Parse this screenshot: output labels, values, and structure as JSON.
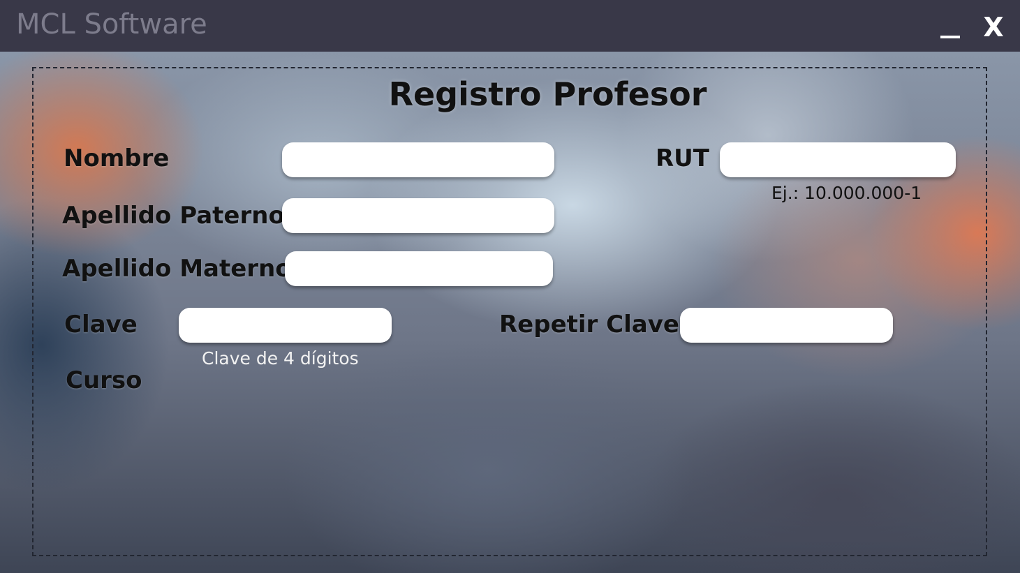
{
  "window": {
    "title": "MCL Software",
    "minimize_label": "_",
    "close_label": "X"
  },
  "form": {
    "title": "Registro Profesor",
    "fields": {
      "nombre": {
        "label": "Nombre",
        "value": ""
      },
      "apellido_paterno": {
        "label": "Apellido Paterno",
        "value": ""
      },
      "apellido_materno": {
        "label": "Apellido Materno",
        "value": ""
      },
      "rut": {
        "label": "RUT",
        "value": "",
        "hint": "Ej.: 10.000.000-1"
      },
      "clave": {
        "label": "Clave",
        "value": "",
        "hint": "Clave de 4 dígitos"
      },
      "repetir_clave": {
        "label": "Repetir Clave",
        "value": ""
      },
      "curso": {
        "label": "Curso"
      }
    }
  },
  "colors": {
    "titlebar": "#393848",
    "title_text": "#7d7c8c",
    "label_text": "#111111",
    "field_background": "#ffffff"
  }
}
